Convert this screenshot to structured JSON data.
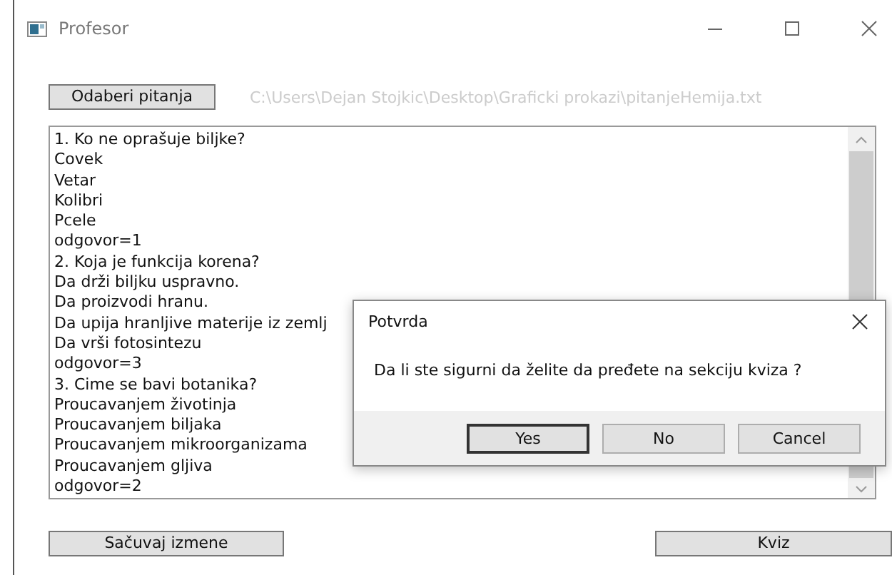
{
  "window": {
    "title": "Profesor"
  },
  "choose_button": "Odaberi pitanja",
  "file_path": "C:\\Users\\Dejan Stojkic\\Desktop\\Graficki prokazi\\pitanjeHemija.txt",
  "text_lines": [
    "1. Ko ne oprašuje biljke?",
    "Covek",
    "Vetar",
    "Kolibri",
    "Pcele",
    "odgovor=1",
    "2. Koja je funkcija korena?",
    "Da drži biljku uspravno.",
    "Da proizvodi hranu.",
    "Da upija hranljive materije iz zemlj",
    "Da vrši fotosintezu",
    "odgovor=3",
    "3. Cime se bavi botanika?",
    "Proucavanjem životinja",
    "Proucavanjem biljaka",
    "Proucavanjem mikroorganizama",
    "Proucavanjem gljiva",
    "odgovor=2"
  ],
  "buttons": [
    "Sačuvaj izmene",
    "Kviz"
  ],
  "dialog": {
    "title": "Potvrda",
    "message": "Da li ste sigurni da želite da pređete na sekciju kviza ?",
    "buttons": [
      {
        "label": "Yes",
        "selected": true
      },
      {
        "label": "No",
        "selected": false
      },
      {
        "label": "Cancel",
        "selected": false
      }
    ]
  }
}
